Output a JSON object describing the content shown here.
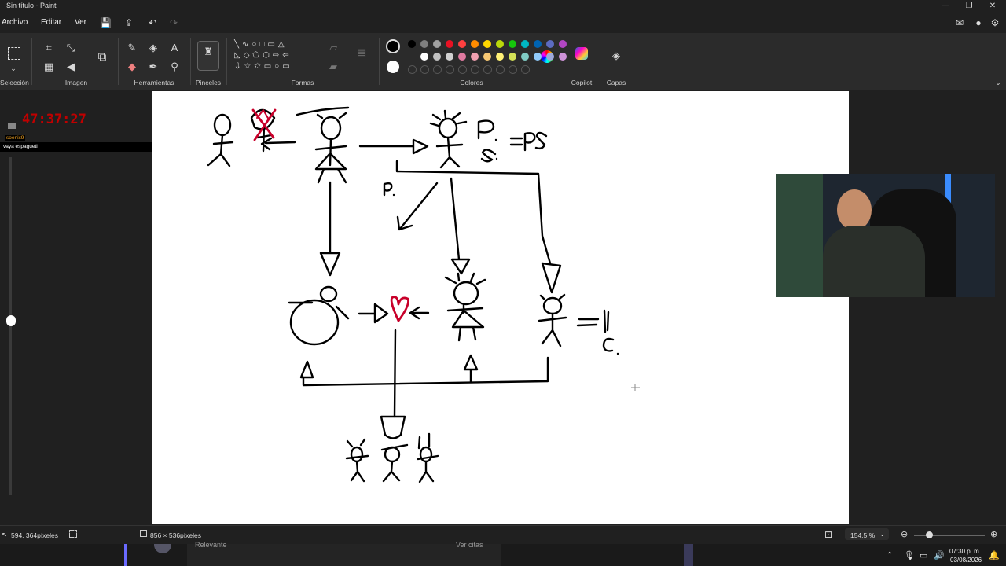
{
  "window": {
    "title": "Sin título - Paint"
  },
  "menu": {
    "file": "Archivo",
    "edit": "Editar",
    "view": "Ver"
  },
  "ribbon": {
    "groups": {
      "selection": "Selección",
      "image": "Imagen",
      "tools": "Herramientas",
      "brushes": "Pinceles",
      "shapes": "Formas",
      "colors": "Colores",
      "copilot": "Copilot",
      "layers": "Capas"
    },
    "swatches_row1": [
      "#000000",
      "#7f7f7f",
      "#a0a0a0",
      "#e81123",
      "#ff4040",
      "#ff8c00",
      "#ffd700",
      "#bad80a",
      "#16c60c",
      "#00b7c3",
      "#0063b1",
      "#5c6bc0",
      "#b146c2"
    ],
    "swatches_row2": [
      "#ffffff",
      "#c0c0c0",
      "#d0d0d0",
      "#e07aa0",
      "#f0a0b0",
      "#f7c873",
      "#fff176",
      "#d4e157",
      "#80cbc4",
      "#90caf9",
      "#9fa8da",
      "#ce93d8"
    ]
  },
  "overlay": {
    "timer": "47:37:27",
    "chat_user": "soenix9",
    "chat_message": "vaya espagueti"
  },
  "canvas_text": {
    "p_label": "P.",
    "s_label": "S.",
    "ps_eq": "=PS",
    "p_small": "P.",
    "c_label": "C."
  },
  "status": {
    "cursor_pos": "594, 364píxeles",
    "canvas_size": "856 × 536píxeles",
    "zoom": "154.5 %"
  },
  "taskbar": {
    "relevant": "Relevante",
    "view_quotes": "Ver citas",
    "time": "07:30 p. m.",
    "date": "03/08/2026"
  }
}
